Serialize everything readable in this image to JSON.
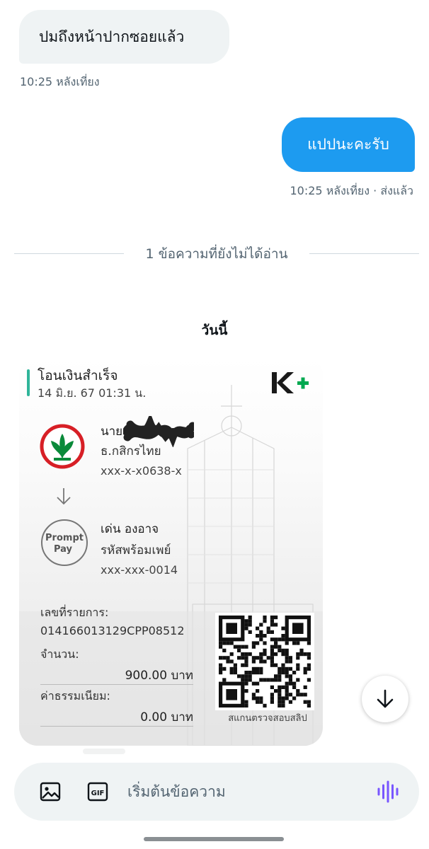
{
  "conversation": {
    "incoming_message": {
      "text": "ปมถึงหน้าปากซอยแล้ว",
      "time": "10:25 หลังเที่ยง"
    },
    "outgoing_message": {
      "text": "แปปนะคะรับ",
      "status": "10:25 หลังเที่ยง · ส่งแล้ว"
    },
    "unread_divider": "1 ข้อความที่ยังไม่ได้อ่าน",
    "day_label": "วันนี้"
  },
  "slip": {
    "title": "โอนเงินสำเร็จ",
    "datetime": "14 มิ.ย. 67  01:31 น.",
    "brand_logo": "K+",
    "sender": {
      "name": "นาย ธ",
      "bank": "ธ.กสิกรไทย",
      "account": "xxx-x-x0638-x",
      "logo": "kasikorn-bank-logo"
    },
    "receiver": {
      "name": "เด่น องอาจ",
      "type": "รหัสพร้อมเพย์",
      "account": "xxx-xxx-0014",
      "logo": "promptpay-logo",
      "logo_text_1": "Prompt",
      "logo_text_2": "Pay"
    },
    "reference_label": "เลขที่รายการ:",
    "reference_value": "014166013129CPP08512",
    "amount_label": "จำนวน:",
    "amount_value": "900.00 บาท",
    "fee_label": "ค่าธรรมเนียม:",
    "fee_value": "0.00 บาท",
    "qr_caption": "สแกนตรวจสอบสลิป",
    "colors": {
      "accent": "#2fb59a",
      "kbank_green": "#0a8a3a",
      "kbank_red": "#d71f26"
    }
  },
  "composer": {
    "placeholder": "เริ่มต้นข้อความ",
    "gif_label": "GIF",
    "icons": [
      "image-icon",
      "gif-icon",
      "voice-icon"
    ]
  },
  "colors": {
    "outgoing_bubble": "#1d9bf0",
    "incoming_bubble": "#eff3f4",
    "secondary_text": "#536471",
    "voice_icon": "#7856ff"
  }
}
